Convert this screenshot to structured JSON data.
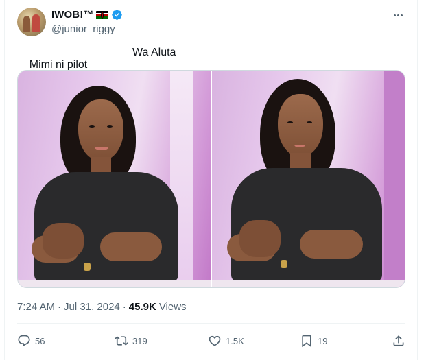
{
  "user": {
    "display_name": "IWOB!™",
    "handle": "@junior_riggy",
    "verified": true,
    "flag": "kenya-flag"
  },
  "tweet": {
    "text_left": "Mimi ni pilot",
    "text_right": "Wa Aluta"
  },
  "meta": {
    "time": "7:24 AM",
    "separator": "·",
    "date": "Jul 31, 2024",
    "views_count": "45.9K",
    "views_label": "Views"
  },
  "actions": {
    "replies": "56",
    "reposts": "319",
    "likes": "1.5K",
    "bookmarks": "19"
  },
  "colors": {
    "text_primary": "#0f1419",
    "text_secondary": "#536471",
    "verified_blue": "#1d9bf0",
    "border": "#cfd9de"
  },
  "icons": [
    "more-icon",
    "verified-icon",
    "reply-icon",
    "repost-icon",
    "like-icon",
    "bookmark-icon",
    "share-icon"
  ]
}
